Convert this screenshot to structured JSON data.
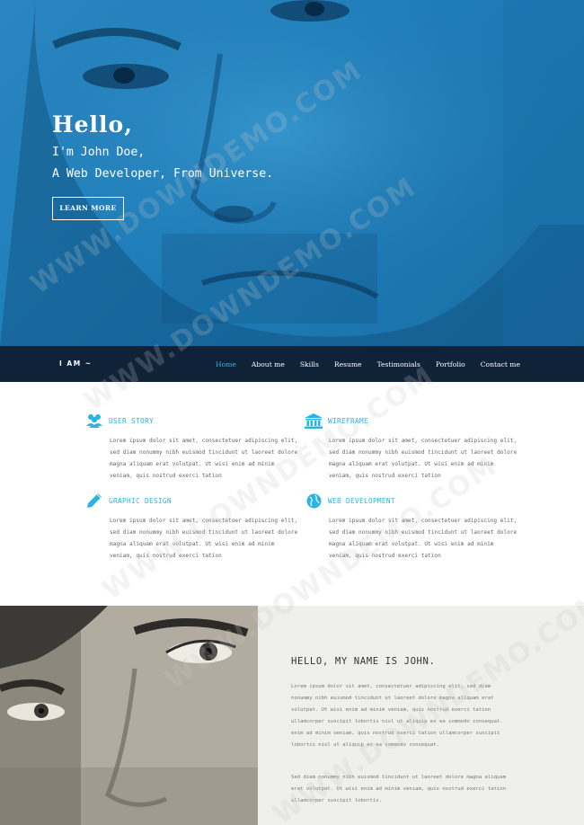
{
  "hero": {
    "greeting": "Hello,",
    "line1": "I'm John Doe,",
    "line2": "A Web Developer, From Universe.",
    "button": "LEARN MORE"
  },
  "nav": {
    "brand": "I AM ~",
    "links": [
      "Home",
      "About me",
      "Skills",
      "Resume",
      "Testimonials",
      "Portfolio",
      "Contact me"
    ],
    "active": "Home"
  },
  "services": [
    {
      "title": "USER STORY",
      "icon": "users-icon",
      "lines": [
        "Lorem ipsum dolor sit amet, consectetuer adipiscing elit,",
        "sed diam nonummy nibh euismod tincidunt ut laoreet dolore",
        "magna aliquam erat volutpat. Ut wisi enim ad minim",
        "veniam, quis nostrud exerci tation"
      ]
    },
    {
      "title": "WIREFRAME",
      "icon": "bank-icon",
      "lines": [
        "Lorem ipsum dolor sit amet, consectetuer adipiscing elit,",
        "sed diam nonummy nibh euismod tincidunt ut laoreet dolore",
        "magna aliquam erat volutpat. Ut wisi enim ad minim",
        "veniam, quis nostrud exerci tation"
      ]
    },
    {
      "title": "GRAPHIC DESIGN",
      "icon": "pencil-icon",
      "lines": [
        "Lorem ipsum dolor sit amet, consectetuer adipiscing elit,",
        "sed diam nonummy nibh euismod tincidunt ut laoreet dolore",
        "magna aliquam erat volutpat. Ut wisi enim ad minim",
        "veniam, quis nostrud exerci tation"
      ]
    },
    {
      "title": "WEB DEVELOPMENT",
      "icon": "globe-icon",
      "lines": [
        "Lorem ipsum dolor sit amet, consectetuer adipiscing elit,",
        "sed diam nonummy nibh euismod tincidunt ut laoreet dolore",
        "magna aliquam erat volutpat. Ut wisi enim ad minim",
        "veniam, quis nostrud exerci tation"
      ]
    }
  ],
  "about": {
    "title": "HELLO, MY NAME IS JOHN.",
    "para1": [
      "Lorem ipsum dolor sit amet, consectetuer adipiscing elit, sed diam",
      "nonummy nibh euismod tincidunt ut laoreet dolore magna aliquam erat",
      "volutpat. Ut wisi enim ad minim veniam, quis nostrud exerci tation",
      "ullamcorper suscipit lobortis nisl ut aliquip ex ea commodo consequat.",
      "enim ad minim veniam, quis nostrud exerci tation ullamcorper suscipit",
      "lobortis nisl ut aliquip ex ea commodo consequat."
    ],
    "para2": [
      "Sed diam nonummy nibh euismod tincidunt ut laoreet dolore magna aliquam",
      "erat volutpat. Ut wisi enim ad minim veniam, quis nostrud exerci tation",
      "ullamcorper suscipit lobortis."
    ]
  },
  "watermark": "WWW.DOWNDEMO.COM",
  "colors": {
    "accent": "#2ab4e6",
    "nav_bg": "#102238",
    "hero_blue": "#1f7fbb"
  }
}
